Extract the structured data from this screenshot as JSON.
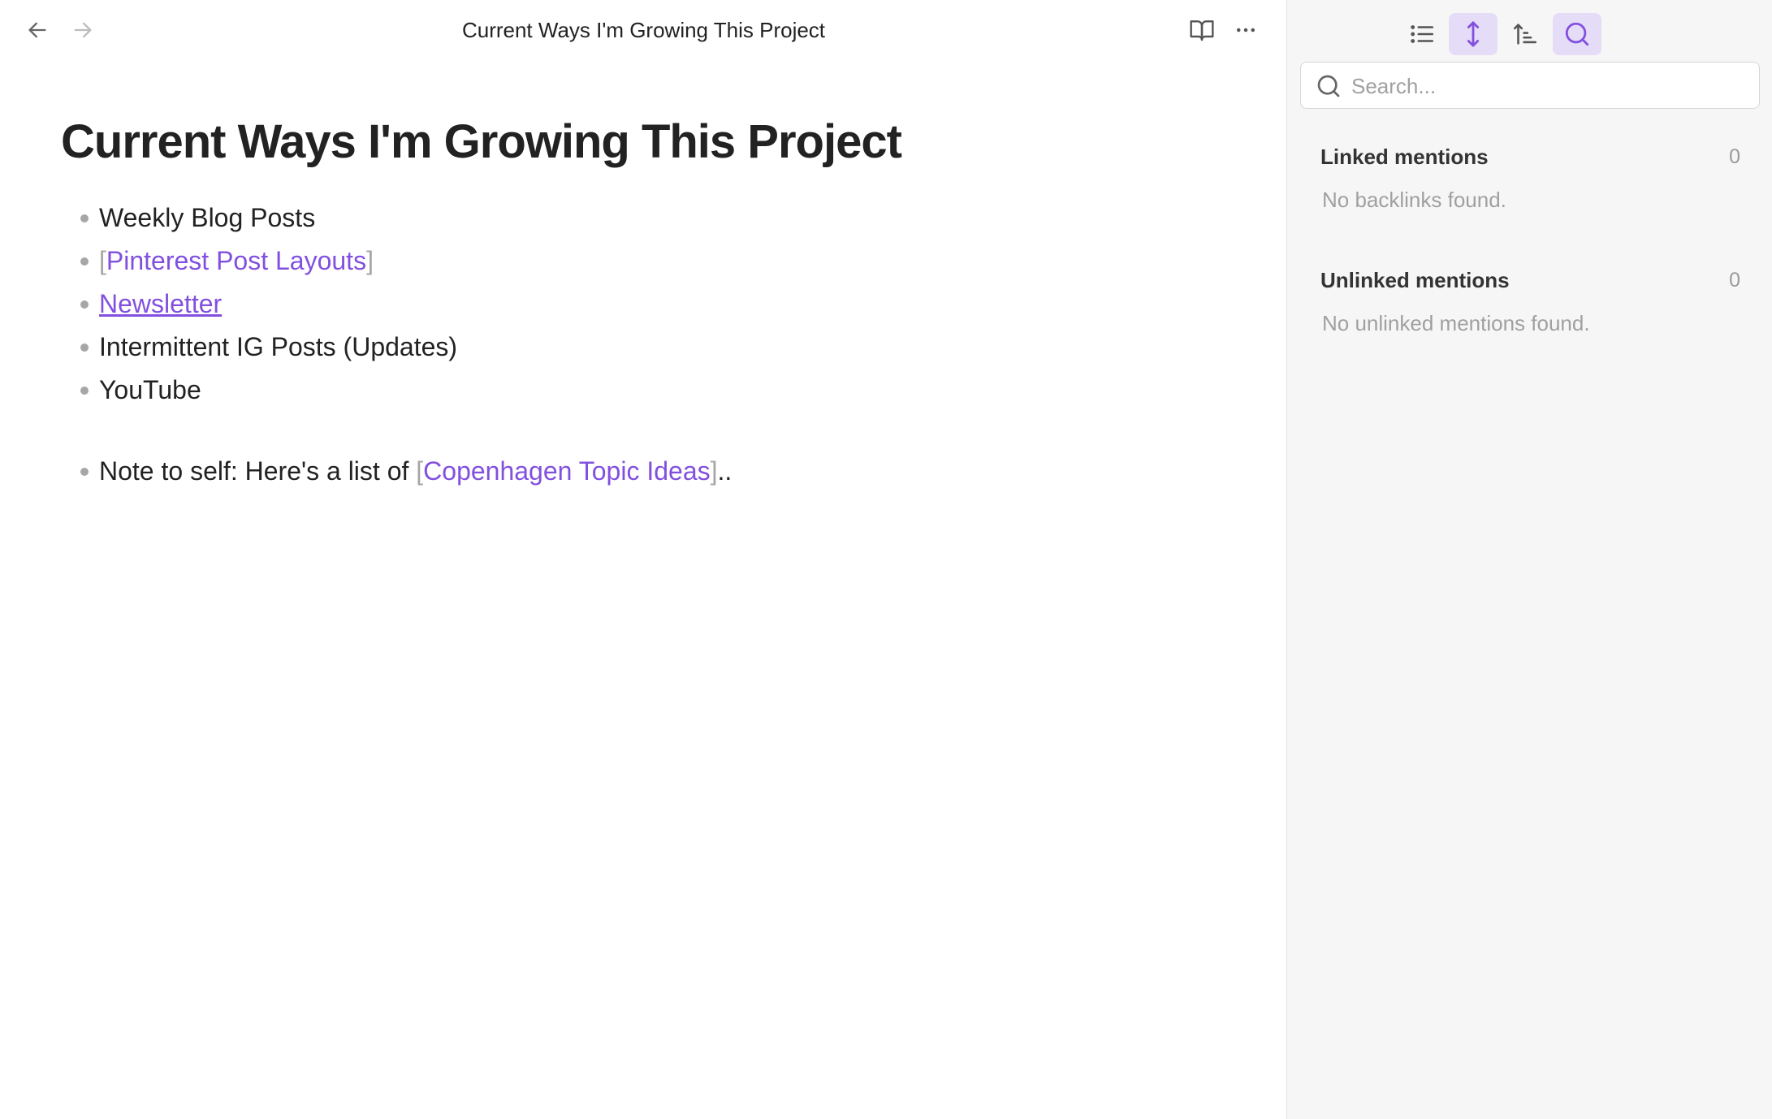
{
  "header": {
    "view_title": "Current Ways I'm Growing This Project"
  },
  "icons": {
    "back": "arrow-left-icon",
    "forward": "arrow-right-icon",
    "reading_view": "open-book-icon",
    "more": "more-horizontal-icon"
  },
  "note": {
    "title": "Current Ways I'm Growing This Project",
    "items": [
      {
        "text": "Weekly Blog Posts"
      },
      {
        "bracket_open": "[",
        "link": "Pinterest Post Layouts",
        "bracket_close": "]"
      },
      {
        "link": "Newsletter"
      },
      {
        "text": "Intermittent IG Posts (Updates)"
      },
      {
        "text": "YouTube"
      }
    ],
    "note_item": {
      "prefix": "Note to self: Here's a list of ",
      "bracket_open": "[",
      "link": "Copenhagen Topic Ideas",
      "bracket_close": "]",
      "suffix": ".."
    }
  },
  "sidebar": {
    "toolbar": [
      {
        "name": "collapse-results-icon",
        "active": false
      },
      {
        "name": "show-more-context-icon",
        "active": true
      },
      {
        "name": "sort-icon",
        "active": false
      },
      {
        "name": "search-toggle-icon",
        "active": true
      }
    ],
    "search": {
      "placeholder": "Search...",
      "value": ""
    },
    "linked": {
      "title": "Linked mentions",
      "count": "0",
      "empty": "No backlinks found."
    },
    "unlinked": {
      "title": "Unlinked mentions",
      "count": "0",
      "empty": "No unlinked mentions found."
    }
  },
  "colors": {
    "accent": "#8250df",
    "active_button_bg": "#e5dcf7",
    "bullet": "#a6a6a6",
    "sidebar_bg": "#f6f6f6"
  }
}
